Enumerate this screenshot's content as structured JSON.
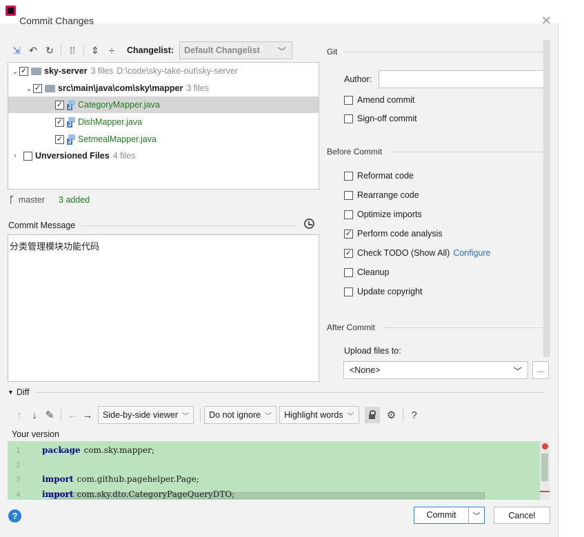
{
  "window": {
    "title": "Commit Changes"
  },
  "toolbar": {
    "changelist_label": "Changelist:",
    "changelist_value": "Default Changelist"
  },
  "tree": {
    "root": {
      "name": "sky-server",
      "count": "3 files",
      "path": "D:\\code\\sky-take-out\\sky-server"
    },
    "folder": {
      "name": "src\\main\\java\\com\\sky\\mapper",
      "count": "3 files"
    },
    "files": [
      "CategoryMapper.java",
      "DishMapper.java",
      "SetmealMapper.java"
    ],
    "unversioned": {
      "name": "Unversioned Files",
      "count": "4 files"
    }
  },
  "status": {
    "branch": "master",
    "added": "3 added"
  },
  "commit_message": {
    "label": "Commit Message",
    "text": "分类管理模块功能代码"
  },
  "git": {
    "title": "Git",
    "author_label": "Author:",
    "author_value": "",
    "amend": "Amend commit",
    "signoff": "Sign-off commit"
  },
  "before_commit": {
    "title": "Before Commit",
    "options": [
      {
        "label": "Reformat code",
        "checked": false
      },
      {
        "label": "Rearrange code",
        "checked": false
      },
      {
        "label": "Optimize imports",
        "checked": false
      },
      {
        "label": "Perform code analysis",
        "checked": true
      },
      {
        "label": "Check TODO (Show All)",
        "checked": true
      },
      {
        "label": "Cleanup",
        "checked": false
      },
      {
        "label": "Update copyright",
        "checked": false
      }
    ],
    "configure_link": "Configure"
  },
  "after_commit": {
    "title": "After Commit",
    "upload_label": "Upload files to:",
    "upload_value": "<None>",
    "more": "..."
  },
  "diff": {
    "label": "Diff",
    "viewer": "Side-by-side viewer",
    "ignore": "Do not ignore",
    "highlight": "Highlight words",
    "help": "?",
    "your_version": "Your version",
    "lines": [
      {
        "num": "1",
        "kw": "package",
        "text": "com.sky.mapper;"
      },
      {
        "num": "2",
        "kw": "",
        "text": ""
      },
      {
        "num": "3",
        "kw": "import",
        "text": "com.github.pagehelper.Page;"
      },
      {
        "num": "4",
        "kw": "import",
        "text": "com.sky.dto.CategoryPageQueryDTO;"
      }
    ]
  },
  "buttons": {
    "commit": "Commit",
    "cancel": "Cancel",
    "help": "?"
  },
  "colors": {
    "diff_added": "#bbe3bd",
    "accent": "#2a6fc9",
    "added_text": "#1f7a1f"
  }
}
